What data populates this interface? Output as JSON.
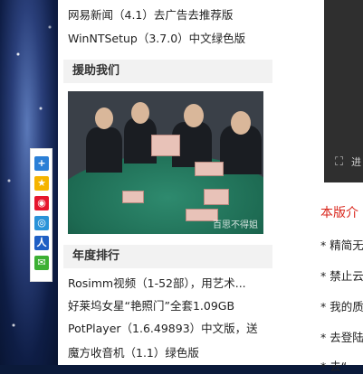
{
  "top_list": [
    "网易新闻（4.1）去广告去推荐版",
    "WinNTSetup（3.7.0）中文绿色版"
  ],
  "sections": {
    "support": {
      "title": "援助我们"
    },
    "ranking": {
      "title": "年度排行"
    }
  },
  "photo": {
    "watermark": "百思不得姐"
  },
  "ranking_list": [
    "Rosimm视频（1-52部），用艺术...",
    "好莱坞女星“艳照门”全套1.09GB",
    "PotPlayer（1.6.49893）中文版，送",
    "魔方收音机（1.1）绿色版"
  ],
  "share_icons": [
    "plus-icon",
    "qzone-icon",
    "weibo-icon",
    "tencent-weibo-icon",
    "renren-icon",
    "wechat-icon"
  ],
  "right": {
    "dark_box_text": "进",
    "notice_title": "本版介",
    "notices": [
      "* 精简无",
      "* 禁止云",
      "* 我的质",
      "* 去登陆",
      "* 去“"
    ]
  },
  "colors": {
    "notice_red": "#d9261c",
    "share_plus": "#2b7fd6",
    "share_qzone": "#f5b400",
    "share_weibo": "#e6162d",
    "share_tencent": "#2a93d8",
    "share_renren": "#1f5fc4",
    "share_wechat": "#3cb034"
  }
}
